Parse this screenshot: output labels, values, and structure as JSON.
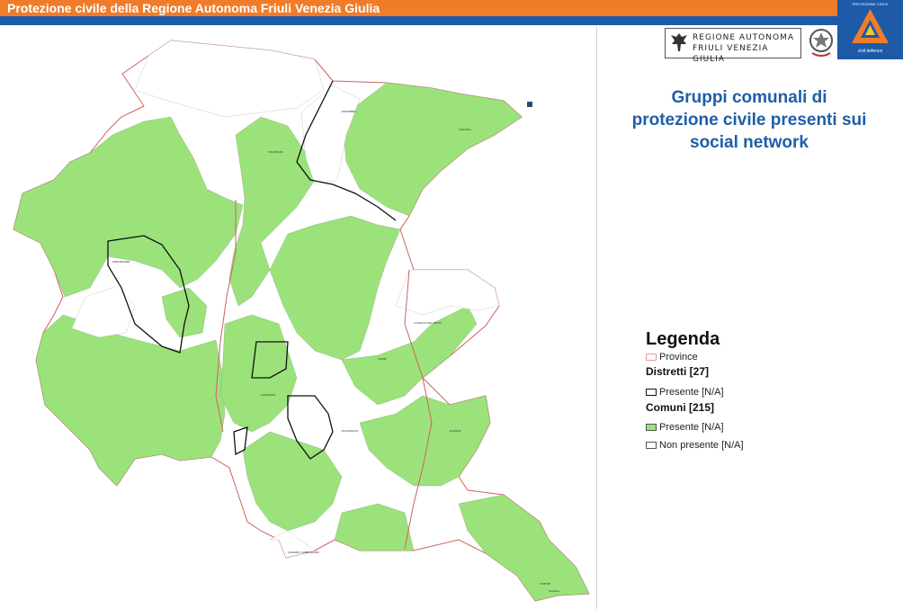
{
  "header": {
    "title": "Protezione civile della Regione Autonoma Friuli Venezia Giulia"
  },
  "logos": {
    "region_line1": "Regione Autonoma",
    "region_line2": "Friuli Venezia Giulia",
    "region_logo_icon": "eagle-icon",
    "emblem_icon": "italian-emblem-icon",
    "pc_logo_icon": "civil-protection-triangle-icon",
    "pc_top_text": "PROTEZIONE CIVILE",
    "pc_bottom_text": "civil defence"
  },
  "subtitle": "Gruppi comunali di protezione civile presenti sui social network",
  "legend": {
    "title": "Legenda",
    "province_label": "Province",
    "districts_heading": "Distretti [27]",
    "districts_label": "Presente [N/A]",
    "comuni_heading": "Comuni [215]",
    "present_label": "Presente [N/A]",
    "absent_label": "Non presente [N/A]"
  },
  "colors": {
    "header_orange": "#f07c2a",
    "header_blue": "#1e5aa8",
    "present_green": "#9be27a",
    "province_border": "#d06060",
    "district_border": "#111111",
    "subtitle_blue": "#1f5ea8"
  },
  "map": {
    "municipality_labels": [
      "PONTEBBA",
      "TARVISIO",
      "TOLMEZZO",
      "UDINE",
      "GORIZIA",
      "TRIESTE",
      "PORDENONE",
      "CODROIPO",
      "PALMANOVA",
      "LIGNANO SABBIADORO",
      "MUGGIA",
      "CIVIDALE DEL FRIULI"
    ]
  }
}
